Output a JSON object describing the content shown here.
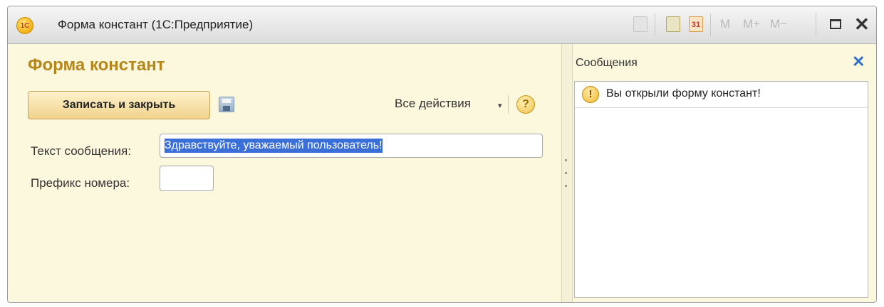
{
  "window": {
    "title": "Форма констант  (1С:Предприятие)",
    "app_icon_text": "1С"
  },
  "toolbar": {
    "calendar_day": "31",
    "m_label": "M",
    "m_plus_label": "M+",
    "m_minus_label": "M−",
    "close_glyph": "✕"
  },
  "form": {
    "title": "Форма констант",
    "save_close_label": "Записать и закрыть",
    "all_actions_label": "Все действия",
    "dropdown_glyph": "▾",
    "help_glyph": "?",
    "message_text_label": "Текст сообщения:",
    "message_text_value": "Здравствуйте, уважаемый пользователь!",
    "number_prefix_label": "Префикс номера:",
    "number_prefix_value": ""
  },
  "messages": {
    "title": "Сообщения",
    "close_glyph": "✕",
    "items": [
      {
        "icon_glyph": "!",
        "text": "Вы открыли форму констант!"
      }
    ]
  },
  "colors": {
    "form_background": "#fbf8dd",
    "form_title": "#b5861c",
    "selection": "#3b6fd8",
    "messages_close": "#2e6fcd"
  }
}
